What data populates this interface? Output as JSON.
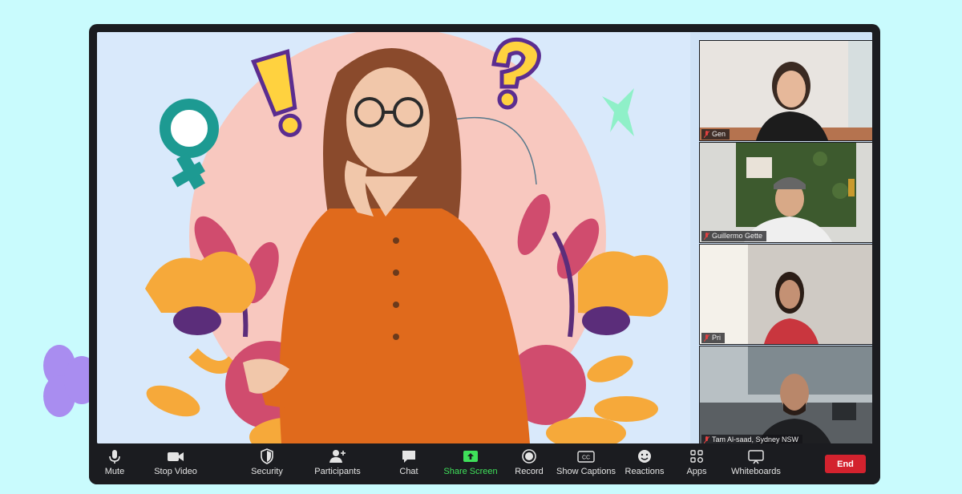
{
  "participants": [
    {
      "name": "Gen"
    },
    {
      "name": "Guillermo Gette"
    },
    {
      "name": "Pri"
    },
    {
      "name": "Tam Al-saad, Sydney NSW"
    }
  ],
  "toolbar": {
    "mute": "Mute",
    "stop_video": "Stop Video",
    "security": "Security",
    "participants": "Participants",
    "chat": "Chat",
    "share_screen": "Share Screen",
    "record": "Record",
    "show_captions": "Show Captions",
    "captions_icon_text": "CC",
    "reactions": "Reactions",
    "apps": "Apps",
    "whiteboards": "Whiteboards",
    "end": "End"
  },
  "colors": {
    "page_bg": "#c9fbfd",
    "toolbar_bg": "#1b1c20",
    "share_green": "#3fe05a",
    "end_red": "#d3222e"
  }
}
